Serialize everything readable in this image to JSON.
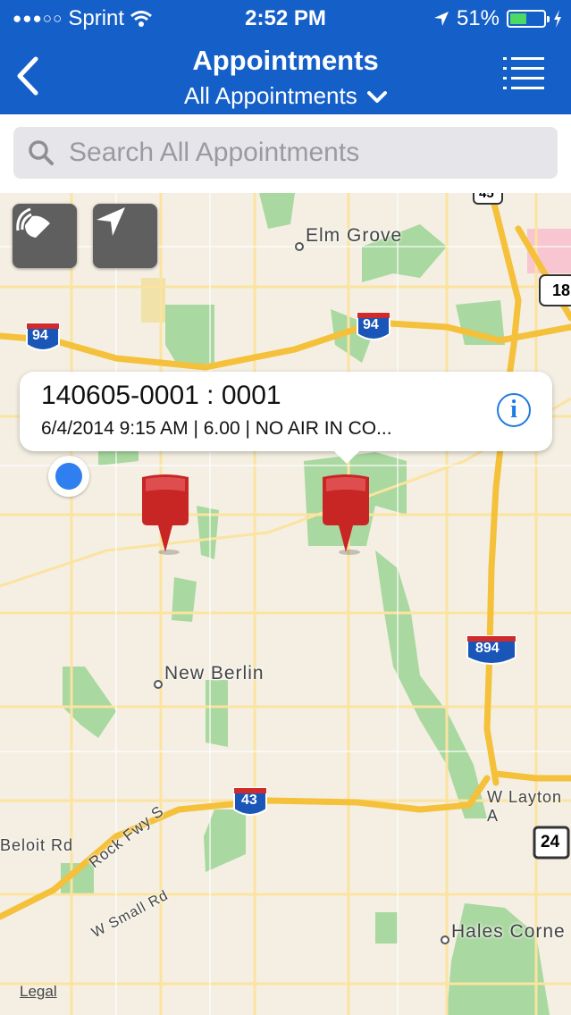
{
  "status_bar": {
    "carrier": "Sprint",
    "signal_dots": "●●●○○",
    "time": "2:52 PM",
    "battery_percent": "51%",
    "battery_level": 0.51,
    "icons": [
      "wifi-icon",
      "location-arrow-icon",
      "battery-icon",
      "charging-bolt-icon"
    ]
  },
  "nav": {
    "title": "Appointments",
    "subtitle": "All Appointments",
    "back_icon": "chevron-left-icon",
    "menu_icon": "list-menu-icon"
  },
  "search": {
    "placeholder": "Search All Appointments",
    "value": "",
    "icon": "search-icon"
  },
  "map": {
    "controls": [
      "map-type-icon",
      "location-arrow-icon"
    ],
    "callout": {
      "title": "140605-0001 : 0001",
      "detail": "6/4/2014 9:15 AM | 6.00 | NO AIR IN CO...",
      "icon": "info-icon"
    },
    "labels": {
      "elm_grove": "Elm Grove",
      "new_berlin": "New Berlin",
      "w_layton": "W Layton A",
      "beloit": "Beloit Rd",
      "rock_fwy": "Rock Fwy S",
      "w_small": "W Small Rd",
      "hales_corners": "Hales Corne"
    },
    "shields": {
      "i94_left": "94",
      "i94_right": "94",
      "i894": "894",
      "i43": "43",
      "us18": "18",
      "us45": "45",
      "wi24": "24"
    },
    "legal": "Legal",
    "colors": {
      "land": "#f4efe2",
      "park": "#a9d8a0",
      "highway": "#f5c03a",
      "nav_bar": "#1560c8",
      "pin": "#d02a2a",
      "user_location": "#2f7ff0"
    }
  }
}
